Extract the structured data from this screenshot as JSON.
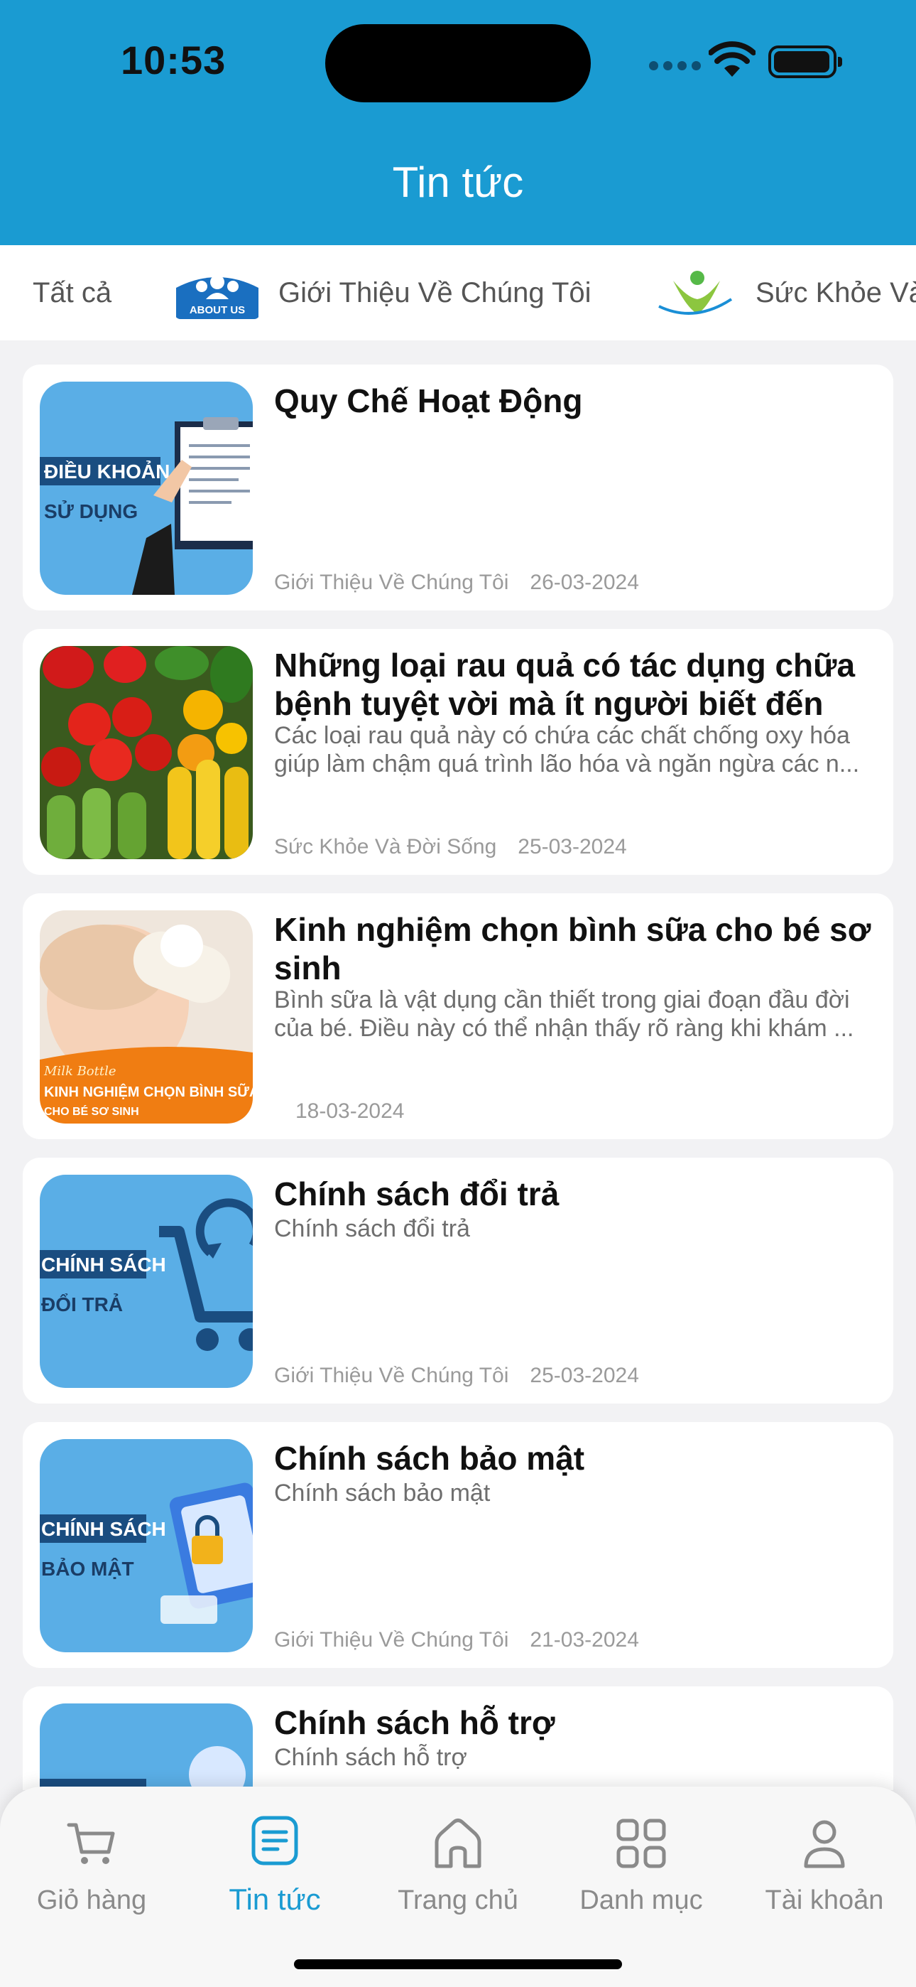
{
  "status_bar": {
    "time": "10:53"
  },
  "header": {
    "title": "Tin tức"
  },
  "categories": [
    {
      "label": "Tất cả",
      "icon": ""
    },
    {
      "label": "Giới Thiệu Về Chúng Tôi",
      "icon": "about-us-icon",
      "icon_text": "ABOUT US"
    },
    {
      "label": "Sức Khỏe Và Đời Sống",
      "icon": "health-icon"
    }
  ],
  "articles": [
    {
      "title": "Quy Chế Hoạt Động",
      "description": "",
      "category": "Giới Thiệu Về Chúng Tôi",
      "date": "26-03-2024",
      "thumb_text": [
        "ĐIỀU KHOẢN",
        "SỬ DỤNG"
      ]
    },
    {
      "title": "Những loại rau quả có tác dụng chữa bệnh tuyệt vời mà ít người biết đến",
      "description": "Các loại rau quả này có chứa các chất chống oxy hóa giúp làm chậm quá trình lão hóa và ngăn ngừa các n...",
      "category": "Sức Khỏe Và Đời Sống",
      "date": "25-03-2024",
      "thumb_text": []
    },
    {
      "title": "Kinh nghiệm chọn bình sữa cho bé sơ sinh",
      "description": "Bình sữa là vật dụng cần thiết trong giai đoạn đầu đời của bé. Điều này có thể nhận thấy rõ ràng khi khám ...",
      "category": "",
      "date": "18-03-2024",
      "thumb_text": [
        "Milk Bottle",
        "KINH NGHIỆM CHỌN BÌNH SỮA",
        "CHO BÉ SƠ SINH"
      ]
    },
    {
      "title": "Chính sách đổi trả",
      "description": "Chính sách đổi trả",
      "category": "Giới Thiệu Về Chúng Tôi",
      "date": "25-03-2024",
      "thumb_text": [
        "CHÍNH SÁCH",
        "ĐỔI TRẢ"
      ]
    },
    {
      "title": "Chính sách bảo mật",
      "description": "Chính sách bảo mật",
      "category": "Giới Thiệu Về Chúng Tôi",
      "date": "21-03-2024",
      "thumb_text": [
        "CHÍNH SÁCH",
        "BẢO MẬT"
      ]
    },
    {
      "title": "Chính sách hỗ trợ",
      "description": "Chính sách hỗ trợ",
      "category": "",
      "date": "",
      "thumb_text": []
    }
  ],
  "bottom_nav": [
    {
      "label": "Giỏ hàng",
      "icon": "cart-icon",
      "active": false
    },
    {
      "label": "Tin tức",
      "icon": "news-icon",
      "active": true
    },
    {
      "label": "Trang chủ",
      "icon": "home-icon",
      "active": false
    },
    {
      "label": "Danh mục",
      "icon": "grid-icon",
      "active": false
    },
    {
      "label": "Tài khoản",
      "icon": "user-icon",
      "active": false
    }
  ],
  "colors": {
    "primary": "#1a9bd2",
    "thumb_blue": "#5aaee6",
    "thumb_navy": "#1a4d80",
    "orange": "#f07d12"
  }
}
